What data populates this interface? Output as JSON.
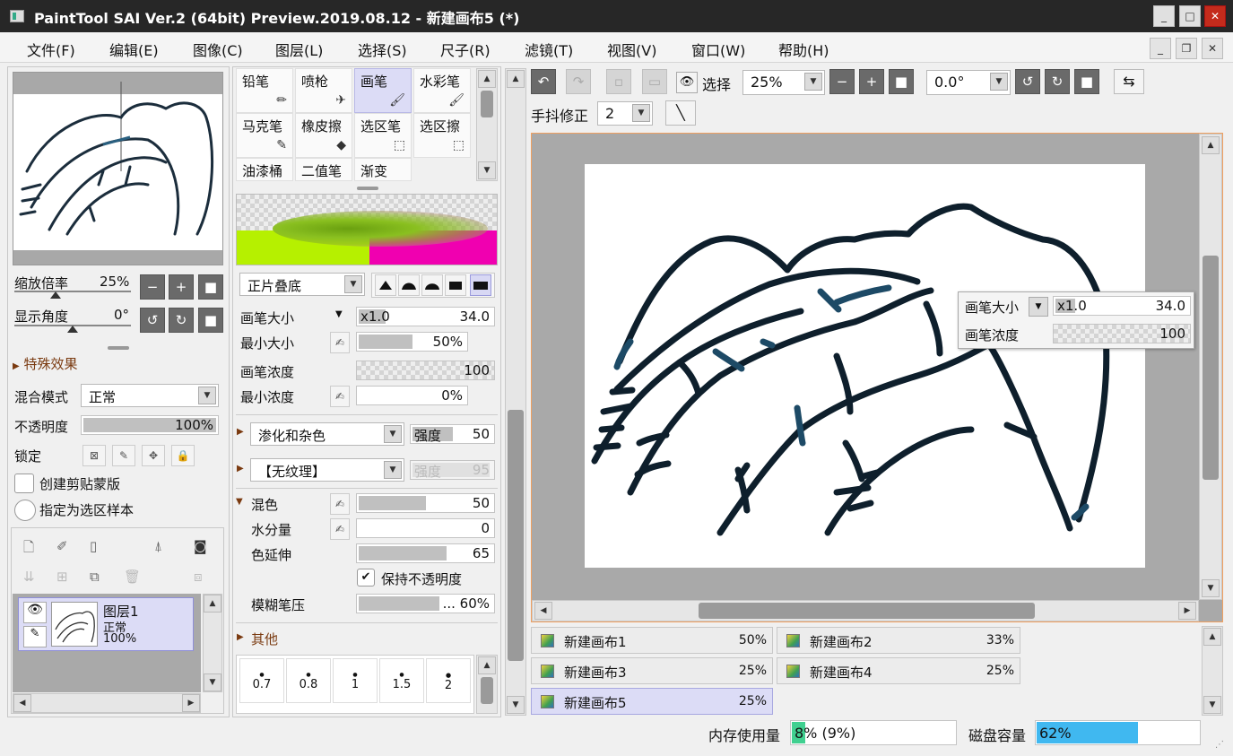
{
  "window": {
    "title": "PaintTool SAI Ver.2 (64bit) Preview.2019.08.12 - 新建画布5 (*)",
    "minimize": "_",
    "maximize": "□",
    "close": "✕"
  },
  "menu": [
    "文件(F)",
    "编辑(E)",
    "图像(C)",
    "图层(L)",
    "选择(S)",
    "尺子(R)",
    "滤镜(T)",
    "视图(V)",
    "窗口(W)",
    "帮助(H)"
  ],
  "mdi": {
    "minimize": "_",
    "restore": "❐",
    "close": "✕"
  },
  "navigator": {
    "zoom_label": "缩放倍率",
    "zoom_value": "25%",
    "angle_label": "显示角度",
    "angle_value": "0°",
    "btn_minus": "−",
    "btn_plus": "+",
    "btn_reset": "■",
    "btn_rot_left": "↺",
    "btn_rot_right": "↻",
    "btn_rot_reset": "■"
  },
  "layer_panel": {
    "effects_label": "特殊效果",
    "blend_label": "混合模式",
    "blend_value": "正常",
    "opacity_label": "不透明度",
    "opacity_value": "100%",
    "opacity_level": 100,
    "lock_label": "锁定",
    "clip_label": "创建剪贴蒙版",
    "sample_label": "指定为选区样本",
    "layers": [
      {
        "name": "图层1",
        "mode": "正常",
        "opacity": "100%"
      }
    ]
  },
  "tools": {
    "items": [
      {
        "label": "铅笔",
        "icon": "pencil-icon"
      },
      {
        "label": "喷枪",
        "icon": "airbrush-icon"
      },
      {
        "label": "画笔",
        "icon": "brush-icon",
        "selected": true
      },
      {
        "label": "水彩笔",
        "icon": "watercolor-icon"
      },
      {
        "label": "马克笔",
        "icon": "marker-icon"
      },
      {
        "label": "橡皮擦",
        "icon": "eraser-icon"
      },
      {
        "label": "选区笔",
        "icon": "select-pen-icon"
      },
      {
        "label": "选区擦",
        "icon": "select-eraser-icon"
      },
      {
        "label": "油漆桶",
        "icon": ""
      },
      {
        "label": "二值笔",
        "icon": ""
      },
      {
        "label": "渐变",
        "icon": ""
      }
    ]
  },
  "brush": {
    "mode_value": "正片叠底",
    "size_label": "画笔大小",
    "size_mult": "x1.0",
    "size_value": "34.0",
    "size_level": 0.2,
    "min_size_label": "最小大小",
    "min_size_value": "50%",
    "min_size_level": 50,
    "density_label": "画笔浓度",
    "density_value": "100",
    "min_density_label": "最小浓度",
    "min_density_value": "0%",
    "blend_noise_value": "渗化和杂色",
    "strength_label": "强度",
    "strength_value": "50",
    "texture_value": "【无纹理】",
    "texture_strength_label": "强度",
    "texture_strength_value": "95",
    "mix_label": "混色",
    "mix_value": "50",
    "mix_level": 50,
    "water_label": "水分量",
    "water_value": "0",
    "stretch_label": "色延伸",
    "stretch_value": "65",
    "stretch_level": 65,
    "keep_opacity_label": "保持不透明度",
    "keep_opacity_checked": "✔",
    "blur_label": "模糊笔压",
    "blur_value": "... 60%",
    "blur_level": 60,
    "other_label": "其他",
    "dot_sizes": [
      "0.7",
      "0.8",
      "1",
      "1.5",
      "2"
    ]
  },
  "toolbar": {
    "select_label": "选择",
    "zoom_value": "25%",
    "angle_value": "0.0°",
    "stabilizer_label": "手抖修正",
    "stabilizer_value": "2"
  },
  "popup": {
    "size_label": "画笔大小",
    "size_mult": "x1.0",
    "size_value": "34.0",
    "density_label": "画笔浓度",
    "density_value": "100"
  },
  "canvas_tabs": [
    {
      "name": "新建画布1",
      "zoom": "50%"
    },
    {
      "name": "新建画布2",
      "zoom": "33%"
    },
    {
      "name": "新建画布3",
      "zoom": "25%"
    },
    {
      "name": "新建画布4",
      "zoom": "25%"
    },
    {
      "name": "新建画布5",
      "zoom": "25%",
      "selected": true
    }
  ],
  "status": {
    "memory_label": "内存使用量",
    "memory_value": "8% (9%)",
    "memory_level": 8,
    "disk_label": "磁盘容量",
    "disk_value": "62%",
    "disk_level": 62
  },
  "colors": {
    "selection": "#dcdcf6",
    "accent_orange": "#f0a060",
    "memory_bar": "#40d090",
    "disk_bar": "#40b8f0"
  }
}
